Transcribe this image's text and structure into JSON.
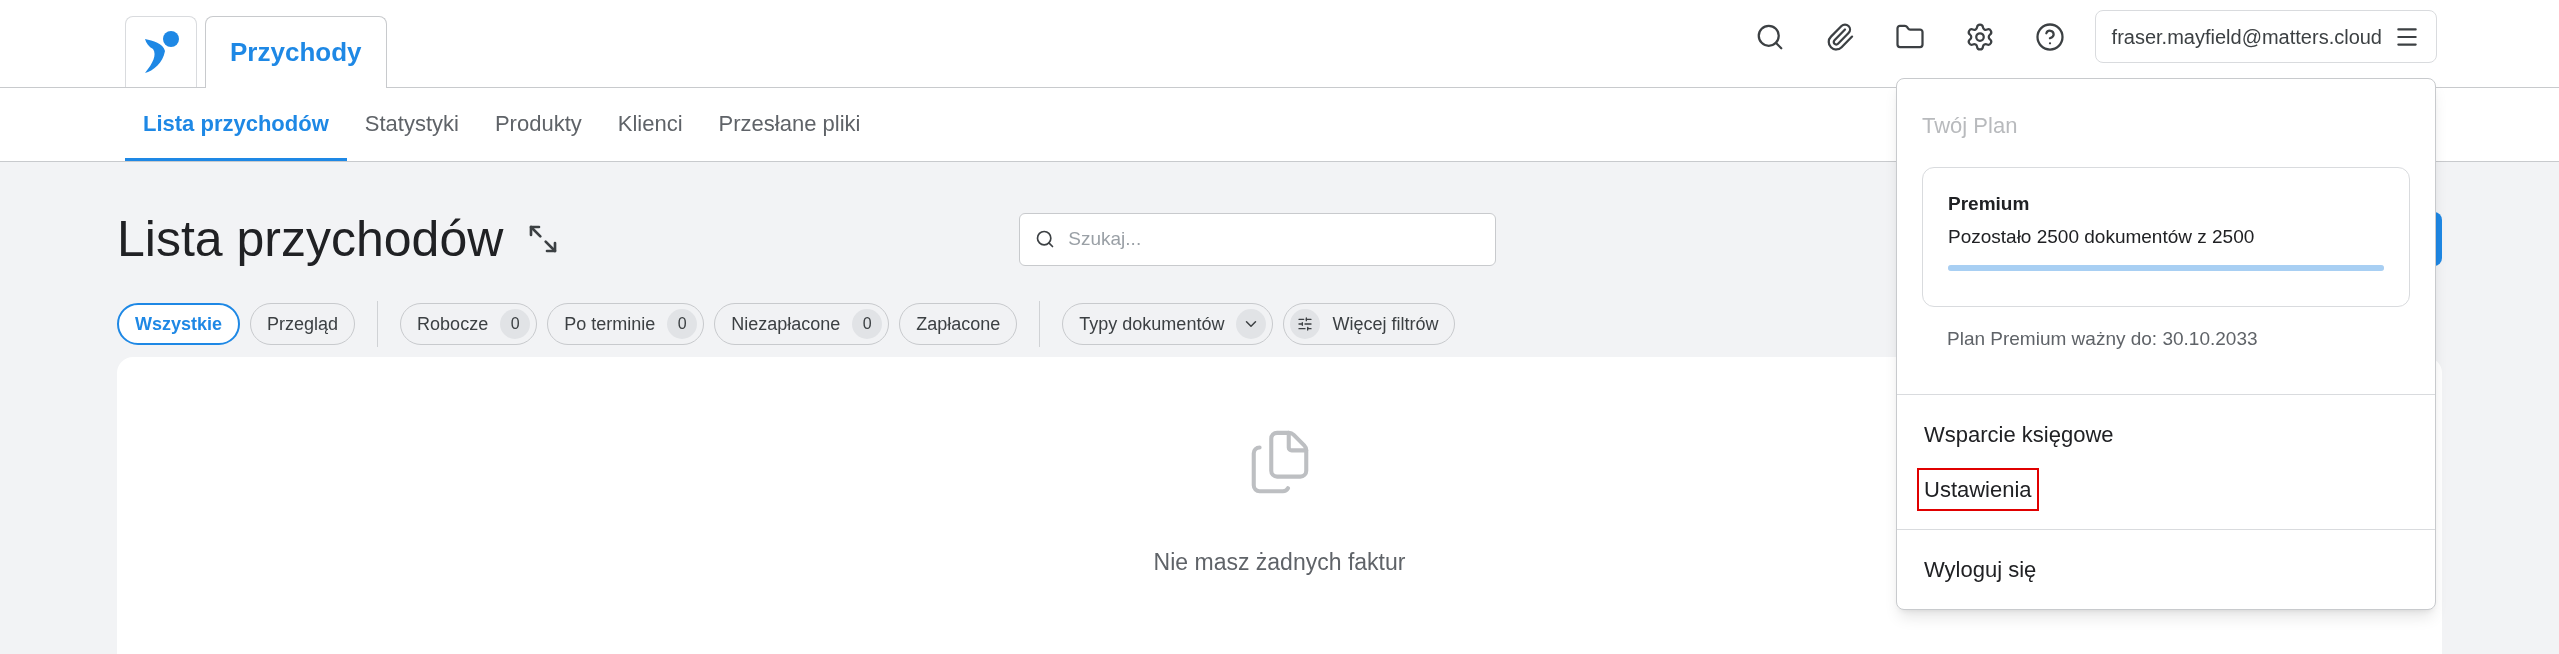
{
  "app_tab": {
    "label": "Przychody",
    "selected": true
  },
  "header_icons": [
    {
      "kind": "search"
    },
    {
      "kind": "paperclip"
    },
    {
      "kind": "folder"
    },
    {
      "kind": "settings"
    },
    {
      "kind": "help"
    }
  ],
  "user_menu": {
    "label": "fraser.mayfield@matters.cloud"
  },
  "subnav": [
    {
      "label": "Lista przychodów",
      "selected": true
    },
    {
      "label": "Statystyki",
      "selected": false
    },
    {
      "label": "Produkty",
      "selected": false
    },
    {
      "label": "Klienci",
      "selected": false
    },
    {
      "label": "Przesłane pliki",
      "selected": false
    }
  ],
  "page_title": "Lista przychodów",
  "search": {
    "placeholder": "Szukaj..."
  },
  "filters": [
    {
      "kind": "chip",
      "label": "Wszystkie",
      "selected": true
    },
    {
      "kind": "chip",
      "label": "Przegląd",
      "selected": false
    },
    {
      "kind": "divider"
    },
    {
      "kind": "count",
      "label": "Robocze",
      "count": "0",
      "selected": false
    },
    {
      "kind": "count",
      "label": "Po terminie",
      "count": "0",
      "selected": false
    },
    {
      "kind": "count",
      "label": "Niezapłacone",
      "count": "0",
      "selected": false
    },
    {
      "kind": "chip",
      "label": "Zapłacone",
      "selected": false
    },
    {
      "kind": "divider"
    },
    {
      "kind": "dropdown",
      "label": "Typy dokumentów",
      "selected": false
    },
    {
      "kind": "more",
      "label": "Więcej filtrów",
      "selected": false
    }
  ],
  "empty_state": {
    "message": "Nie masz żadnych faktur"
  },
  "dropdown": {
    "heading": "Twój Plan",
    "plan": {
      "name": "Premium",
      "remaining": "Pozostało 2500 dokumentów z 2500",
      "level": 1
    },
    "validity": "Plan Premium ważny do: 30.10.2033",
    "groups": [
      [
        {
          "label": "Wsparcie księgowe",
          "highlighted": false
        },
        {
          "label": "Ustawienia",
          "highlighted": true
        }
      ],
      [
        {
          "label": "Wyloguj się",
          "highlighted": false
        }
      ]
    ]
  }
}
